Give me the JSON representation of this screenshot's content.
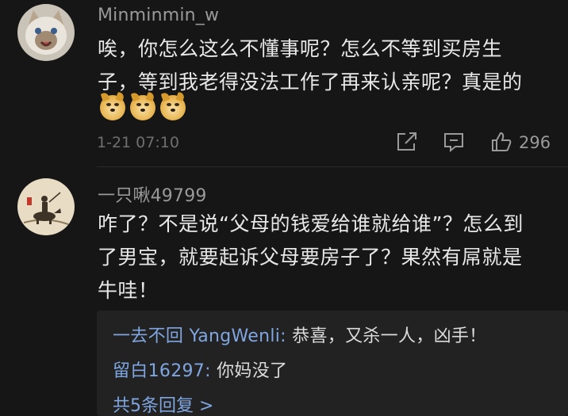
{
  "comments": [
    {
      "username": "Minminmin_w",
      "text_line1": "唉，你怎么这么不懂事呢？怎么不等到买房生",
      "text_line2": "子，等到我老得没法工作了再来认亲呢？真是的",
      "emoji": [
        "doge-emoji",
        "doge-emoji",
        "doge-emoji"
      ],
      "timestamp": "1-21 07:10",
      "likes": "296"
    },
    {
      "username": "一只啾49799",
      "text_line1": "咋了？不是说“父母的钱爱给谁就给谁”？怎么到",
      "text_line2": "了男宝，就要起诉父母要房子了？果然有屌就是",
      "text_line3": "牛哇！",
      "replies": [
        {
          "author": "一去不回 YangWenli:",
          "content": " 恭喜，又杀一人，凶手！"
        },
        {
          "author": "留白16297:",
          "content": " 你妈没了"
        }
      ],
      "more_replies": "共5条回复 >"
    }
  ],
  "colors": {
    "background": "#161616",
    "reply_background": "#222222",
    "link_blue": "#7fa6e0",
    "username_gray": "#9a9a9a"
  }
}
